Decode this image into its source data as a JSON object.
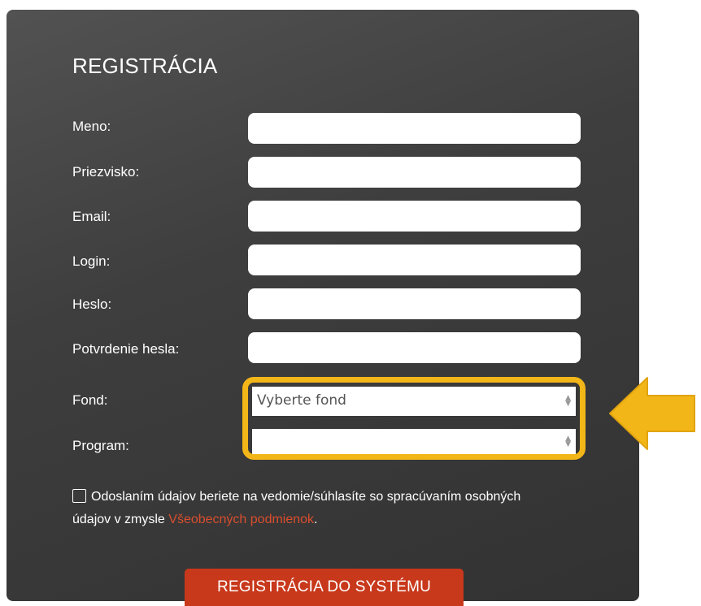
{
  "form": {
    "title": "REGISTRÁCIA",
    "fields": [
      {
        "label": "Meno:",
        "value": ""
      },
      {
        "label": "Priezvisko:",
        "value": ""
      },
      {
        "label": "Email:",
        "value": ""
      },
      {
        "label": "Login:",
        "value": ""
      },
      {
        "label": "Heslo:",
        "value": ""
      },
      {
        "label": "Potvrdenie hesla:",
        "value": ""
      }
    ],
    "fond": {
      "label": "Fond:",
      "selected": "Vyberte fond"
    },
    "program": {
      "label": "Program:",
      "selected": ""
    },
    "consent": {
      "text_before": "Odoslaním údajov beriete na vedomie/súhlasíte so spracúvaním osobných údajov v zmysle ",
      "link_text": "Všeobecných podmienok",
      "text_after": "."
    },
    "submit_label": "REGISTRÁCIA DO SYSTÉMU"
  },
  "annotation": {
    "highlight_color": "#f3b618",
    "arrow_icon": "arrow-left-icon"
  },
  "colors": {
    "panel": "#3e3e3e",
    "accent": "#c8381b",
    "link": "#d94e2e"
  }
}
